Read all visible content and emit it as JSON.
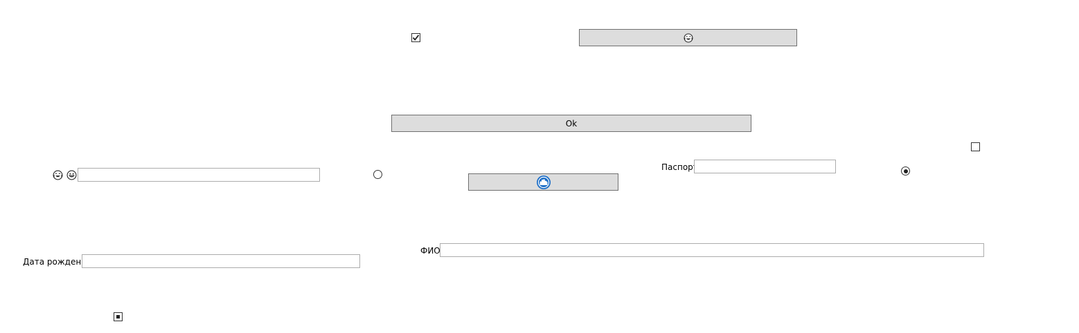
{
  "buttons": {
    "ok_label": "Ok",
    "emoji_button_icon": "grinning-tears-emoji-icon",
    "logo_button_icon": "cloud-logo-icon"
  },
  "labels": {
    "passport": "Паспорт",
    "full_name": "ФИО",
    "birth_date": "Дата рождения"
  },
  "fields": {
    "passport_value": "",
    "full_name_value": "",
    "birth_date_value": "",
    "emoji_field_value": ""
  },
  "emoji_label": {
    "icons": [
      "tears-of-joy-emoji-icon",
      "grinning-emoji-icon"
    ]
  },
  "checkboxes": {
    "top_checked": true,
    "right_checked": false,
    "bottom_indeterminate": true
  },
  "radios": {
    "left_selected": false,
    "right_selected": true
  },
  "colors": {
    "button_bg": "#dddddd",
    "button_border": "#707070",
    "field_border": "#acacac",
    "logo_blue": "#1e6fc7"
  }
}
